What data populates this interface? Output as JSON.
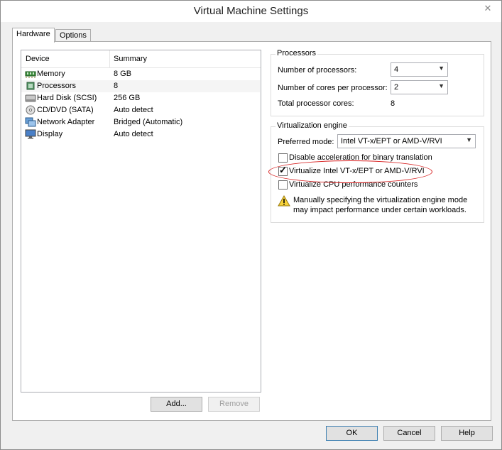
{
  "window": {
    "title": "Virtual Machine Settings",
    "close_glyph": "✕"
  },
  "tabs": [
    {
      "label": "Hardware",
      "active": true
    },
    {
      "label": "Options",
      "active": false
    }
  ],
  "device_list": {
    "headers": {
      "device": "Device",
      "summary": "Summary"
    },
    "rows": [
      {
        "name": "Memory",
        "summary": "8 GB",
        "icon": "memory-icon"
      },
      {
        "name": "Processors",
        "summary": "8",
        "icon": "processor-icon",
        "selected": true
      },
      {
        "name": "Hard Disk (SCSI)",
        "summary": "256 GB",
        "icon": "hard-disk-icon"
      },
      {
        "name": "CD/DVD (SATA)",
        "summary": "Auto detect",
        "icon": "cd-dvd-icon"
      },
      {
        "name": "Network Adapter",
        "summary": "Bridged (Automatic)",
        "icon": "network-adapter-icon"
      },
      {
        "name": "Display",
        "summary": "Auto detect",
        "icon": "display-icon"
      }
    ]
  },
  "list_buttons": {
    "add": "Add...",
    "remove": "Remove"
  },
  "processors": {
    "title": "Processors",
    "num_processors_label": "Number of processors:",
    "num_processors_value": "4",
    "cores_label": "Number of cores per processor:",
    "cores_value": "2",
    "total_label": "Total processor cores:",
    "total_value": "8"
  },
  "virtualization": {
    "title": "Virtualization engine",
    "mode_label": "Preferred mode:",
    "mode_value": "Intel VT-x/EPT or AMD-V/RVI",
    "checkboxes": [
      {
        "label": "Disable acceleration for binary translation",
        "checked": false
      },
      {
        "label": "Virtualize Intel VT-x/EPT or AMD-V/RVI",
        "checked": true
      },
      {
        "label": "Virtualize CPU performance counters",
        "checked": false
      }
    ],
    "warning": "Manually specifying the virtualization engine mode may impact performance under certain workloads."
  },
  "dialog_buttons": {
    "ok": "OK",
    "cancel": "Cancel",
    "help": "Help"
  },
  "colors": {
    "highlight_ellipse": "#d72020",
    "selected_row": "#f5f5f5"
  }
}
